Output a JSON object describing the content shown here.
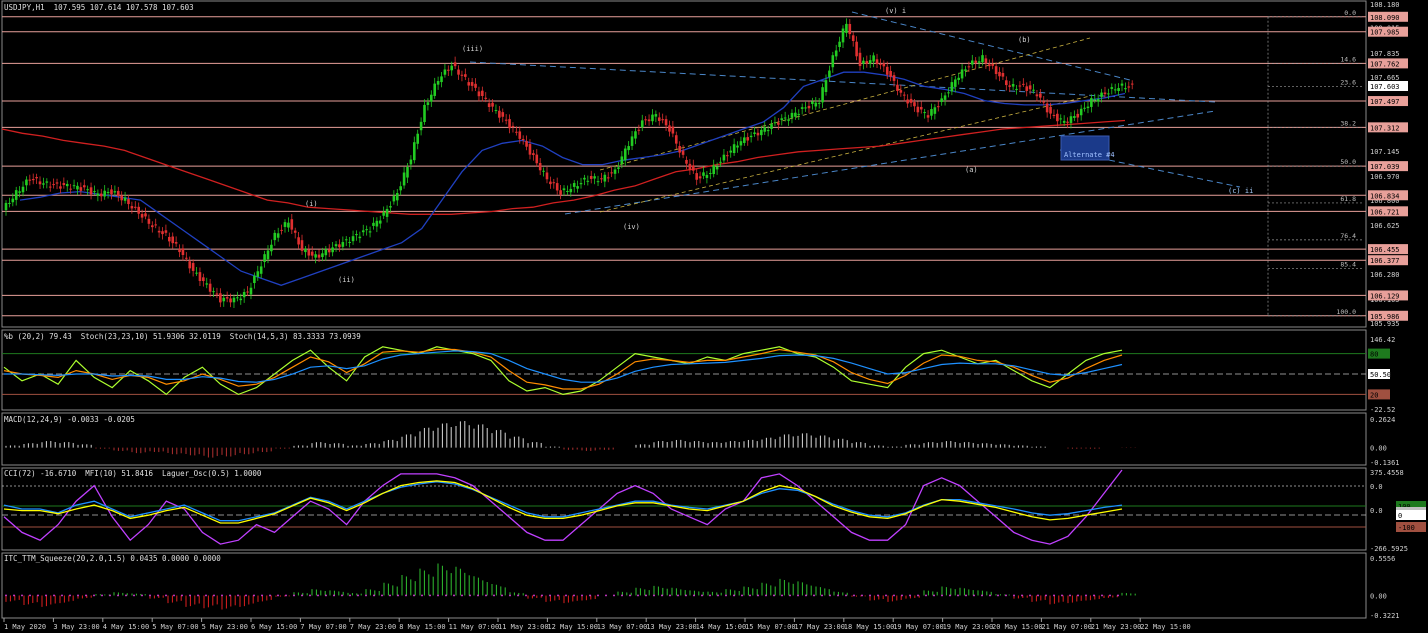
{
  "chart_data": {
    "type": "line",
    "symbol_header": "USDJPY,H1  107.595 107.614 107.578 107.603",
    "price_axis": {
      "ticks": [
        "108.180",
        "108.015",
        "107.835",
        "107.665",
        "107.495",
        "107.315",
        "107.145",
        "106.970",
        "106.800",
        "106.625",
        "106.455",
        "106.280",
        "106.105",
        "105.935"
      ],
      "range": [
        105.935,
        108.18
      ]
    },
    "current_price": "107.603",
    "level_tags": [
      "108.090",
      "107.985",
      "107.762",
      "107.497",
      "107.312",
      "107.039",
      "106.834",
      "106.721",
      "106.455",
      "106.377",
      "106.129",
      "105.986"
    ],
    "fib_labels": [
      {
        "text": "0.0",
        "price": 108.09
      },
      {
        "text": "14.6",
        "price": 107.76
      },
      {
        "text": "23.6",
        "price": 107.6
      },
      {
        "text": "38.2",
        "price": 107.312
      },
      {
        "text": "50.0",
        "price": 107.039
      },
      {
        "text": "61.8",
        "price": 106.78
      },
      {
        "text": "76.4",
        "price": 106.52
      },
      {
        "text": "85.4",
        "price": 106.32
      },
      {
        "text": "100.0",
        "price": 105.986
      }
    ],
    "wave_labels": [
      "(v)  i",
      "(iii)",
      "(b)",
      "(a)",
      "(iv)",
      "(i)",
      "(ii)",
      "(c)  ii",
      "(c)  ii",
      "Alternate #4"
    ],
    "x_labels": [
      "1 May 2020",
      "3 May 23:00",
      "4 May 15:00",
      "5 May 07:00",
      "5 May 23:00",
      "6 May 15:00",
      "7 May 07:00",
      "7 May 23:00",
      "8 May 15:00",
      "11 May 07:00",
      "11 May 23:00",
      "12 May 15:00",
      "13 May 07:00",
      "13 May 23:00",
      "14 May 15:00",
      "15 May 07:00",
      "17 May 23:00",
      "18 May 15:00",
      "19 May 07:00",
      "19 May 23:00",
      "20 May 15:00",
      "21 May 07:00",
      "21 May 23:00",
      "22 May 15:00"
    ],
    "close": [
      106.73,
      106.85,
      106.95,
      106.92,
      106.9,
      106.9,
      106.88,
      106.84,
      106.86,
      106.8,
      106.71,
      106.62,
      106.55,
      106.45,
      106.3,
      106.2,
      106.1,
      106.1,
      106.15,
      106.35,
      106.55,
      106.65,
      106.45,
      106.4,
      106.45,
      106.5,
      106.55,
      106.6,
      106.7,
      106.85,
      107.1,
      107.45,
      107.65,
      107.75,
      107.65,
      107.55,
      107.45,
      107.35,
      107.25,
      107.1,
      106.95,
      106.85,
      106.9,
      106.95,
      106.95,
      107,
      107.2,
      107.35,
      107.4,
      107.3,
      107.1,
      106.95,
      107,
      107.1,
      107.2,
      107.25,
      107.3,
      107.35,
      107.4,
      107.45,
      107.5,
      107.8,
      108.05,
      107.75,
      107.8,
      107.7,
      107.55,
      107.45,
      107.4,
      107.5,
      107.65,
      107.75,
      107.8,
      107.7,
      107.6,
      107.6,
      107.55,
      107.4,
      107.35,
      107.4,
      107.5,
      107.55,
      107.6
    ],
    "ma200": [
      107.3,
      107.27,
      107.25,
      107.22,
      107.2,
      107.18,
      107.15,
      107.1,
      107.05,
      107,
      106.95,
      106.9,
      106.85,
      106.8,
      106.78,
      106.75,
      106.74,
      106.73,
      106.72,
      106.71,
      106.7,
      106.7,
      106.7,
      106.71,
      106.72,
      106.74,
      106.75,
      106.78,
      106.8,
      106.83,
      106.87,
      106.9,
      106.95,
      107,
      107.02,
      107.05,
      107.07,
      107.1,
      107.12,
      107.14,
      107.15,
      107.16,
      107.17,
      107.18,
      107.2,
      107.22,
      107.24,
      107.26,
      107.28,
      107.3,
      107.31,
      107.32,
      107.33,
      107.34,
      107.35,
      107.36
    ],
    "ma50": [
      106.8,
      106.82,
      106.85,
      106.86,
      106.84,
      106.82,
      106.8,
      106.7,
      106.6,
      106.5,
      106.4,
      106.3,
      106.25,
      106.2,
      106.25,
      106.3,
      106.35,
      106.4,
      106.45,
      106.5,
      106.6,
      106.8,
      107,
      107.15,
      107.2,
      107.22,
      107.18,
      107.1,
      107.05,
      107.05,
      107.08,
      107.1,
      107.12,
      107.15,
      107.2,
      107.25,
      107.3,
      107.35,
      107.45,
      107.6,
      107.65,
      107.7,
      107.7,
      107.68,
      107.65,
      107.6,
      107.58,
      107.55,
      107.5,
      107.48,
      107.47,
      107.47,
      107.48,
      107.5,
      107.52,
      107.55
    ],
    "oscillator_panels": [
      {
        "header": "%b (20,2) 79.43  Stoch(23,23,10) 51.9306 32.0119  Stoch(14,5,3) 83.3333 73.0939",
        "ticks": [
          "146.42",
          "50.50",
          "-22.52"
        ],
        "tags": [
          "80",
          "50.50",
          "20"
        ],
        "series": [
          {
            "color": "#adff2f",
            "values": [
              60,
              40,
              50,
              35,
              70,
              45,
              30,
              55,
              40,
              20,
              45,
              60,
              35,
              20,
              30,
              50,
              70,
              85,
              60,
              40,
              75,
              90,
              85,
              80,
              90,
              85,
              80,
              70,
              40,
              25,
              30,
              20,
              25,
              40,
              60,
              80,
              75,
              70,
              65,
              75,
              70,
              80,
              85,
              90,
              80,
              75,
              60,
              40,
              35,
              30,
              60,
              80,
              85,
              75,
              65,
              70,
              55,
              40,
              30,
              50,
              70,
              80,
              85
            ]
          },
          {
            "color": "#ff8c00",
            "values": [
              55,
              50,
              48,
              45,
              55,
              50,
              42,
              48,
              45,
              35,
              40,
              50,
              42,
              32,
              35,
              45,
              60,
              75,
              68,
              52,
              65,
              82,
              84,
              82,
              86,
              86,
              82,
              75,
              55,
              38,
              34,
              28,
              28,
              35,
              50,
              68,
              72,
              70,
              67,
              70,
              70,
              75,
              80,
              86,
              82,
              78,
              68,
              52,
              42,
              36,
              48,
              66,
              78,
              76,
              70,
              68,
              60,
              48,
              38,
              44,
              58,
              70,
              78
            ]
          },
          {
            "color": "#1e90ff",
            "values": [
              50,
              50,
              49,
              48,
              50,
              50,
              47,
              48,
              47,
              42,
              42,
              46,
              44,
              39,
              38,
              42,
              50,
              60,
              62,
              58,
              62,
              72,
              78,
              80,
              82,
              84,
              83,
              80,
              70,
              58,
              50,
              42,
              38,
              38,
              44,
              54,
              60,
              64,
              65,
              66,
              67,
              70,
              73,
              77,
              78,
              77,
              73,
              66,
              58,
              50,
              52,
              58,
              64,
              66,
              65,
              65,
              62,
              56,
              50,
              48,
              52,
              58,
              64
            ]
          }
        ]
      },
      {
        "header": "MACD(12,24,9) -0.0033 -0.0205",
        "ticks": [
          "0.2624",
          "0.00",
          "-0.1361"
        ],
        "tags": [],
        "hist": [
          0.02,
          0.04,
          0.06,
          0.05,
          0.03,
          -0.01,
          -0.03,
          -0.05,
          -0.04,
          -0.06,
          -0.07,
          -0.09,
          -0.08,
          -0.06,
          -0.04,
          -0.01,
          0.02,
          0.05,
          0.04,
          0.02,
          0.04,
          0.07,
          0.12,
          0.18,
          0.22,
          0.24,
          0.21,
          0.16,
          0.1,
          0.05,
          0.01,
          -0.02,
          -0.03,
          -0.02,
          0.0,
          0.03,
          0.06,
          0.07,
          0.06,
          0.05,
          0.06,
          0.07,
          0.09,
          0.12,
          0.13,
          0.11,
          0.08,
          0.05,
          0.02,
          0.01,
          0.03,
          0.05,
          0.06,
          0.05,
          0.04,
          0.03,
          0.02,
          0.01,
          0.0,
          -0.01,
          -0.01,
          0.0,
          -0.003
        ]
      },
      {
        "header": "CCI(72) -16.6710  MFI(10) 51.8416  Laguer_Osc(0.5) 1.0000",
        "ticks": [
          "375.4558",
          "0.0",
          "0.0",
          "-266.5925"
        ],
        "tags": [
          "100",
          "-100",
          "50",
          "0"
        ],
        "series": [
          {
            "color": "#c040ff",
            "values": [
              40,
              20,
              10,
              30,
              60,
              80,
              40,
              10,
              30,
              60,
              50,
              20,
              5,
              10,
              30,
              20,
              40,
              60,
              50,
              30,
              60,
              80,
              95,
              95,
              95,
              90,
              80,
              60,
              40,
              20,
              10,
              10,
              30,
              50,
              70,
              80,
              70,
              50,
              40,
              30,
              50,
              60,
              90,
              95,
              80,
              60,
              40,
              20,
              10,
              10,
              30,
              80,
              90,
              80,
              60,
              40,
              20,
              10,
              5,
              15,
              40,
              70,
              100
            ]
          },
          {
            "color": "#1e90ff",
            "values": [
              55,
              50,
              50,
              45,
              55,
              60,
              50,
              40,
              45,
              50,
              55,
              45,
              35,
              35,
              40,
              45,
              55,
              65,
              60,
              50,
              60,
              70,
              78,
              82,
              85,
              82,
              75,
              65,
              55,
              45,
              40,
              40,
              45,
              50,
              55,
              60,
              60,
              55,
              52,
              50,
              55,
              60,
              70,
              76,
              74,
              66,
              56,
              48,
              42,
              40,
              45,
              55,
              62,
              62,
              58,
              54,
              50,
              45,
              42,
              44,
              48,
              52,
              55
            ]
          },
          {
            "color": "#ffff00",
            "values": [
              50,
              48,
              48,
              44,
              50,
              55,
              48,
              38,
              42,
              48,
              52,
              42,
              32,
              32,
              38,
              44,
              54,
              64,
              58,
              48,
              58,
              70,
              80,
              84,
              86,
              84,
              76,
              64,
              52,
              42,
              38,
              38,
              42,
              48,
              54,
              58,
              58,
              54,
              50,
              48,
              54,
              60,
              72,
              80,
              76,
              66,
              54,
              46,
              40,
              38,
              44,
              54,
              62,
              60,
              56,
              52,
              46,
              40,
              36,
              38,
              42,
              46,
              50
            ]
          }
        ]
      },
      {
        "header": "ITC_TTM_Squeeze(20,2.0,1.5) 0.0435 0.0000 0.0000",
        "ticks": [
          "0.5556",
          "0.00",
          "-0.3221"
        ],
        "tags": [],
        "hist": [
          -0.1,
          -0.15,
          -0.18,
          -0.12,
          -0.05,
          0.02,
          0.05,
          0.03,
          -0.05,
          -0.12,
          -0.18,
          -0.2,
          -0.22,
          -0.18,
          -0.1,
          -0.02,
          0.05,
          0.1,
          0.08,
          0.04,
          0.1,
          0.2,
          0.32,
          0.42,
          0.5,
          0.45,
          0.3,
          0.18,
          0.05,
          -0.05,
          -0.1,
          -0.12,
          -0.08,
          0.0,
          0.06,
          0.12,
          0.15,
          0.12,
          0.08,
          0.06,
          0.1,
          0.14,
          0.2,
          0.26,
          0.22,
          0.14,
          0.06,
          -0.02,
          -0.08,
          -0.1,
          -0.05,
          0.08,
          0.14,
          0.12,
          0.08,
          0.02,
          -0.05,
          -0.1,
          -0.14,
          -0.12,
          -0.08,
          -0.04,
          0.04
        ]
      }
    ]
  }
}
